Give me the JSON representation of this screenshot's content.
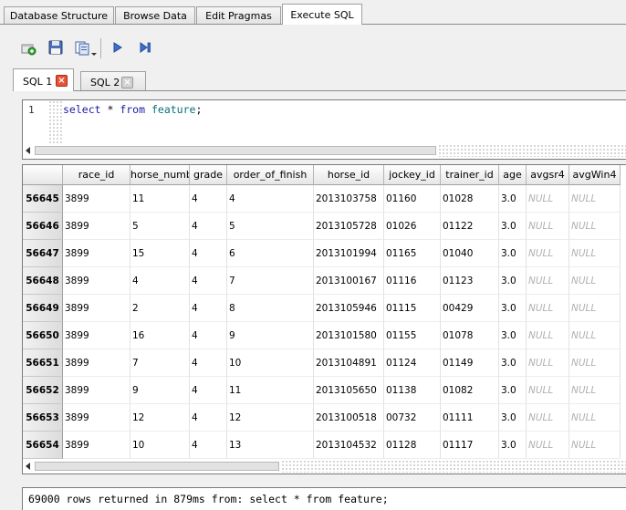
{
  "main_tabs": [
    {
      "label": "Database Structure",
      "active": false
    },
    {
      "label": "Browse Data",
      "active": false
    },
    {
      "label": "Edit Pragmas",
      "active": false
    },
    {
      "label": "Execute SQL",
      "active": true
    }
  ],
  "toolbar": {
    "buttons": [
      {
        "icon": "open-tab-icon"
      },
      {
        "icon": "open-sql-file-icon"
      },
      {
        "icon": "save-sql-file-icon"
      },
      {
        "icon": "execute-all-icon"
      },
      {
        "icon": "execute-current-line-icon"
      }
    ]
  },
  "sql_tabs": [
    {
      "label": "SQL 1",
      "active": true
    },
    {
      "label": "SQL 2",
      "active": false
    }
  ],
  "editor": {
    "line_number": "1",
    "code": {
      "kw1": "select",
      "star": " * ",
      "kw2": "from",
      "space": " ",
      "table": "feature",
      "semi": ";"
    }
  },
  "grid": {
    "columns": [
      "race_id",
      "horse_number",
      "grade",
      "order_of_finish",
      "horse_id",
      "jockey_id",
      "trainer_id",
      "age",
      "avgsr4",
      "avgWin4"
    ],
    "rows": [
      {
        "rownum": "56645",
        "cells": [
          "3899",
          "11",
          "4",
          "4",
          "2013103758",
          "01160",
          "01028",
          "3.0",
          "NULL",
          "NULL"
        ]
      },
      {
        "rownum": "56646",
        "cells": [
          "3899",
          "5",
          "4",
          "5",
          "2013105728",
          "01026",
          "01122",
          "3.0",
          "NULL",
          "NULL"
        ]
      },
      {
        "rownum": "56647",
        "cells": [
          "3899",
          "15",
          "4",
          "6",
          "2013101994",
          "01165",
          "01040",
          "3.0",
          "NULL",
          "NULL"
        ]
      },
      {
        "rownum": "56648",
        "cells": [
          "3899",
          "4",
          "4",
          "7",
          "2013100167",
          "01116",
          "01123",
          "3.0",
          "NULL",
          "NULL"
        ]
      },
      {
        "rownum": "56649",
        "cells": [
          "3899",
          "2",
          "4",
          "8",
          "2013105946",
          "01115",
          "00429",
          "3.0",
          "NULL",
          "NULL"
        ]
      },
      {
        "rownum": "56650",
        "cells": [
          "3899",
          "16",
          "4",
          "9",
          "2013101580",
          "01155",
          "01078",
          "3.0",
          "NULL",
          "NULL"
        ]
      },
      {
        "rownum": "56651",
        "cells": [
          "3899",
          "7",
          "4",
          "10",
          "2013104891",
          "01124",
          "01149",
          "3.0",
          "NULL",
          "NULL"
        ]
      },
      {
        "rownum": "56652",
        "cells": [
          "3899",
          "9",
          "4",
          "11",
          "2013105650",
          "01138",
          "01082",
          "3.0",
          "NULL",
          "NULL"
        ]
      },
      {
        "rownum": "56653",
        "cells": [
          "3899",
          "12",
          "4",
          "12",
          "2013100518",
          "00732",
          "01111",
          "3.0",
          "NULL",
          "NULL"
        ]
      },
      {
        "rownum": "56654",
        "cells": [
          "3899",
          "10",
          "4",
          "13",
          "2013104532",
          "01128",
          "01117",
          "3.0",
          "NULL",
          "NULL"
        ]
      }
    ]
  },
  "status": {
    "message": "69000 rows returned in 879ms from: select * from feature;"
  }
}
